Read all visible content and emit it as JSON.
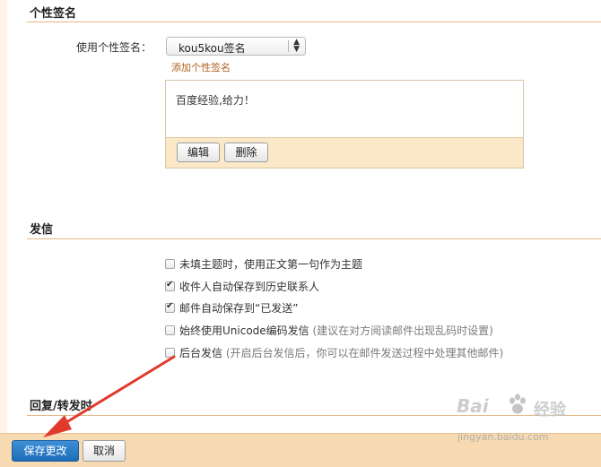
{
  "signature_section": {
    "title": "个性签名",
    "use_label": "使用个性签名：",
    "selected_signature": "kou5kou签名",
    "add_link": "添加个性签名",
    "signature_text": "百度经验,给力！",
    "edit_label": "编辑",
    "delete_label": "删除"
  },
  "send_section": {
    "title": "发信",
    "options": [
      {
        "label": "未填主题时，使用正文第一句作为主题",
        "hint": "",
        "checked": false
      },
      {
        "label": "收件人自动保存到历史联系人",
        "hint": "",
        "checked": true
      },
      {
        "label": "邮件自动保存到“已发送”",
        "hint": "",
        "checked": true
      },
      {
        "label": "始终使用Unicode编码发信",
        "hint": "(建议在对方阅读邮件出现乱码时设置)",
        "checked": false
      },
      {
        "label": "后台发信",
        "hint": "(开启后台发信后，你可以在邮件发送过程中处理其他邮件)",
        "checked": false
      }
    ]
  },
  "reply_section": {
    "title": "回复/转发时"
  },
  "footer": {
    "save_label": "保存更改",
    "cancel_label": "取消"
  },
  "watermark": {
    "logo_text": "Bai",
    "logo_cn": "经验",
    "url": "jingyan.baidu.com"
  },
  "colors": {
    "accent_line": "#e2b989",
    "toolbar_bg": "#fbe8c9",
    "footer_bg": "#f7dab1",
    "save_button": "#2a7bc6",
    "arrow": "#e03a2c",
    "link": "#b06020"
  }
}
